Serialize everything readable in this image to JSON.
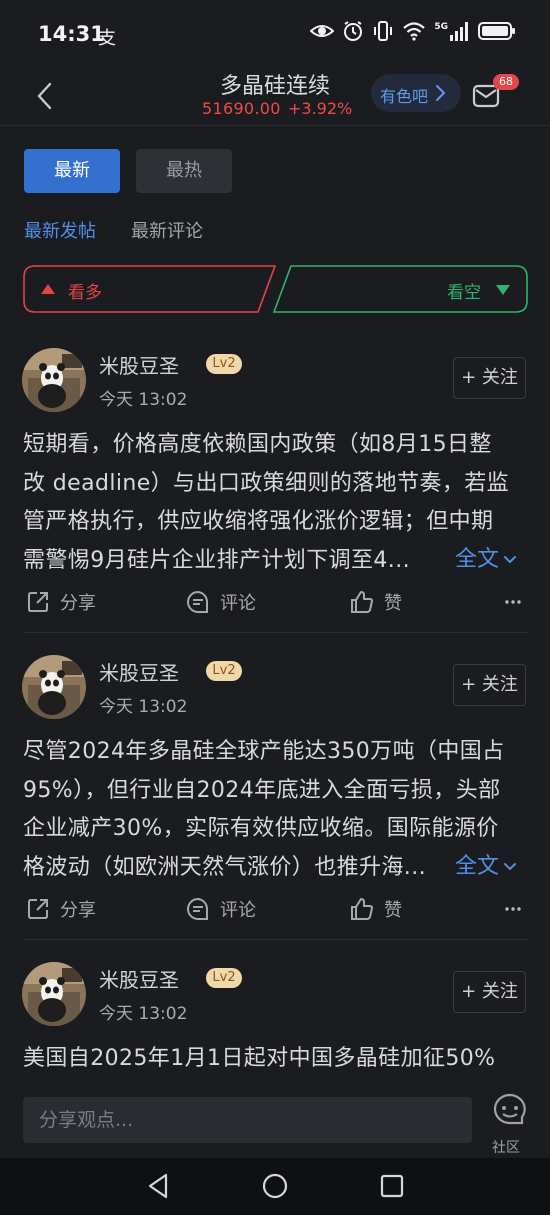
{
  "status_bar": {
    "time": "14:31",
    "time_mark": "支",
    "network": "5G",
    "icons": [
      "eye-icon",
      "alarm-icon",
      "vibrate-icon",
      "wifi-icon",
      "signal-icon",
      "battery-icon"
    ]
  },
  "header": {
    "title": "多晶硅连续",
    "price": "51690.00",
    "change": "+3.92%",
    "bar_button": "有色吧",
    "unread_count": "68"
  },
  "tabs": [
    {
      "label": "最新",
      "active": true
    },
    {
      "label": "最热",
      "active": false
    }
  ],
  "subtabs": [
    {
      "label": "最新发帖",
      "active": true
    },
    {
      "label": "最新评论",
      "active": false
    }
  ],
  "sentiment": {
    "bull_label": "看多",
    "bear_label": "看空"
  },
  "posts": [
    {
      "username": "米股豆圣",
      "level": "Lv2",
      "time": "今天 13:02",
      "follow_label": "+ 关注",
      "lines": [
        "短期看，价格高度依赖国内政策（如8月15日整",
        "改 deadline）与出口政策细则的落地节奏，若监",
        "管严格执行，供应收缩将强化涨价逻辑；但中期",
        "需警惕9月硅片企业排产计划下调至4..."
      ],
      "full_text_label": "全文",
      "share_label": "分享",
      "comment_label": "评论",
      "like_label": "赞"
    },
    {
      "username": "米股豆圣",
      "level": "Lv2",
      "time": "今天 13:02",
      "follow_label": "+ 关注",
      "lines": [
        "尽管2024年多晶硅全球产能达350万吨（中国占",
        "95%），但行业自2024年底进入全面亏损，头部",
        "企业减产30%，实际有效供应收缩。国际能源价",
        "格波动（如欧洲天然气涨价）也推升海..."
      ],
      "full_text_label": "全文",
      "share_label": "分享",
      "comment_label": "评论",
      "like_label": "赞"
    },
    {
      "username": "米股豆圣",
      "level": "Lv2",
      "time": "今天 13:02",
      "follow_label": "+ 关注",
      "lines": [
        "美国自2025年1月1日起对中国多晶硅加征50%"
      ]
    }
  ],
  "bottom_bar": {
    "input_placeholder": "分享观点...",
    "community_label": "社区"
  },
  "colors": {
    "background": "#1b1c20",
    "accent_blue": "#3471cf",
    "link_blue": "#4f8fe8",
    "up_red": "#e24545",
    "down_green": "#2fb36e",
    "badge_gold": "#f2d8a8"
  }
}
